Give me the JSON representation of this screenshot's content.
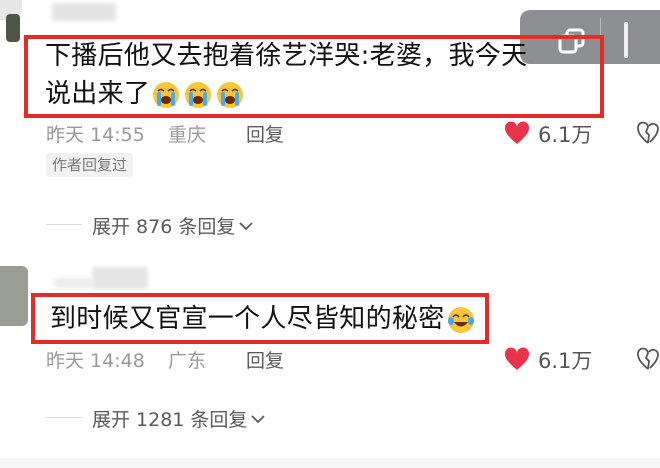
{
  "comments": [
    {
      "text_line1": "下播后他又去抱着徐艺洋哭:老婆，我今天",
      "text_line2": "说出来了",
      "emoji": "loudly-crying-face",
      "time": "昨天 14:55",
      "location": "重庆",
      "reply_label": "回复",
      "likes": "6.1万",
      "author_tag": "作者回复过",
      "expand_label": "展开 876 条回复"
    },
    {
      "text": "到时候又官宣一个人尽皆知的秘密",
      "emoji": "face-with-tears-of-joy",
      "time": "昨天 14:48",
      "location": "广东",
      "reply_label": "回复",
      "likes": "6.1万",
      "expand_label": "展开 1281 条回复"
    }
  ],
  "colors": {
    "highlight_red": "#e32b27",
    "like_red": "#e8334a",
    "meta_gray": "#9a9a9a"
  },
  "icons": [
    "copy-icon",
    "heart-icon",
    "broken-heart-icon",
    "chevron-down-icon"
  ]
}
